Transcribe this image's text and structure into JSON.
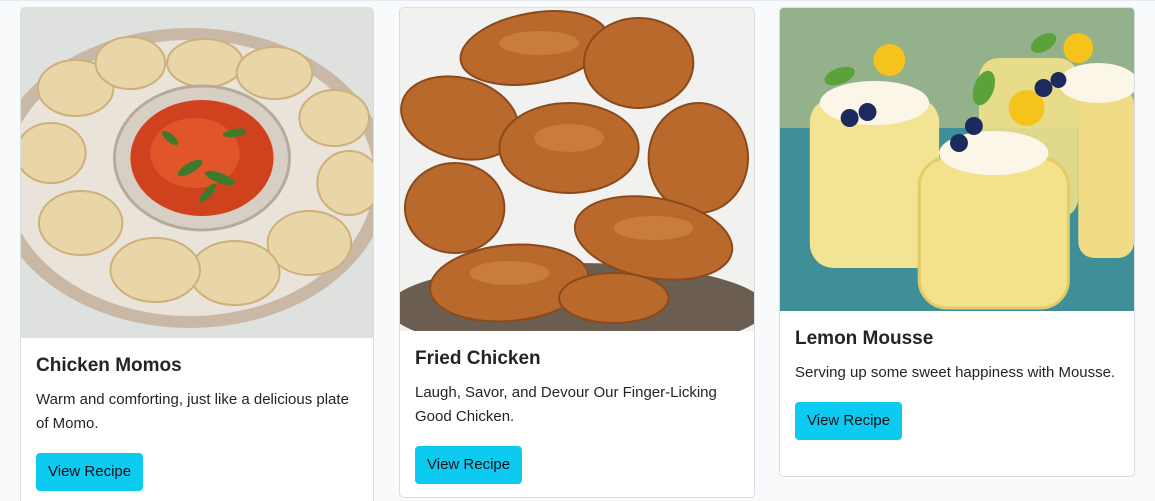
{
  "cards": [
    {
      "title": "Chicken Momos",
      "text": "Warm and comforting, just like a delicious plate of Momo.",
      "button": "View Recipe",
      "image_alt": "Plate of chicken momos with red dipping sauce"
    },
    {
      "title": "Fried Chicken",
      "text": "Laugh, Savor, and Devour Our Finger-Licking Good Chicken.",
      "button": "View Recipe",
      "image_alt": "Pile of crispy fried chicken pieces"
    },
    {
      "title": "Lemon Mousse",
      "text": "Serving up some sweet happiness with Mousse.",
      "button": "View Recipe",
      "image_alt": "Jars of lemon mousse topped with cream, blueberries and mint"
    }
  ],
  "colors": {
    "button_bg": "#0dcaf0",
    "card_border": "#d9dde2",
    "page_bg": "#f8fafc"
  }
}
